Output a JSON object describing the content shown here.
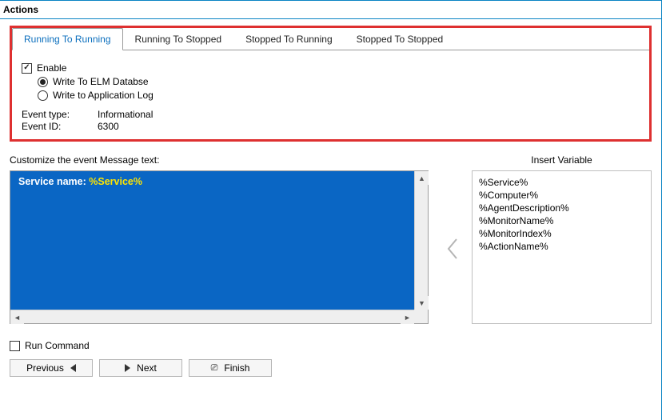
{
  "window": {
    "title": "Actions"
  },
  "tabs": {
    "items": [
      {
        "label": "Running To Running",
        "active": true
      },
      {
        "label": "Running To Stopped",
        "active": false
      },
      {
        "label": "Stopped To Running",
        "active": false
      },
      {
        "label": "Stopped To Stopped",
        "active": false
      }
    ]
  },
  "enable": {
    "label": "Enable",
    "checked": true
  },
  "write_options": {
    "elm": {
      "label": "Write To ELM Databse",
      "checked": true
    },
    "applog": {
      "label": "Write to Application Log",
      "checked": false
    }
  },
  "event": {
    "type_label": "Event type:",
    "type_value": "Informational",
    "id_label": "Event ID:",
    "id_value": "6300"
  },
  "message_section": {
    "label": "Customize the event Message text:",
    "static_text": "Service name: ",
    "variable_text": "%Service%"
  },
  "insert_variable": {
    "title": "Insert Variable",
    "items": [
      "%Service%",
      "%Computer%",
      "%AgentDescription%",
      "%MonitorName%",
      "%MonitorIndex%",
      "%ActionName%"
    ]
  },
  "run_command": {
    "label": "Run Command",
    "checked": false
  },
  "buttons": {
    "previous": "Previous",
    "next": "Next",
    "finish": "Finish"
  }
}
